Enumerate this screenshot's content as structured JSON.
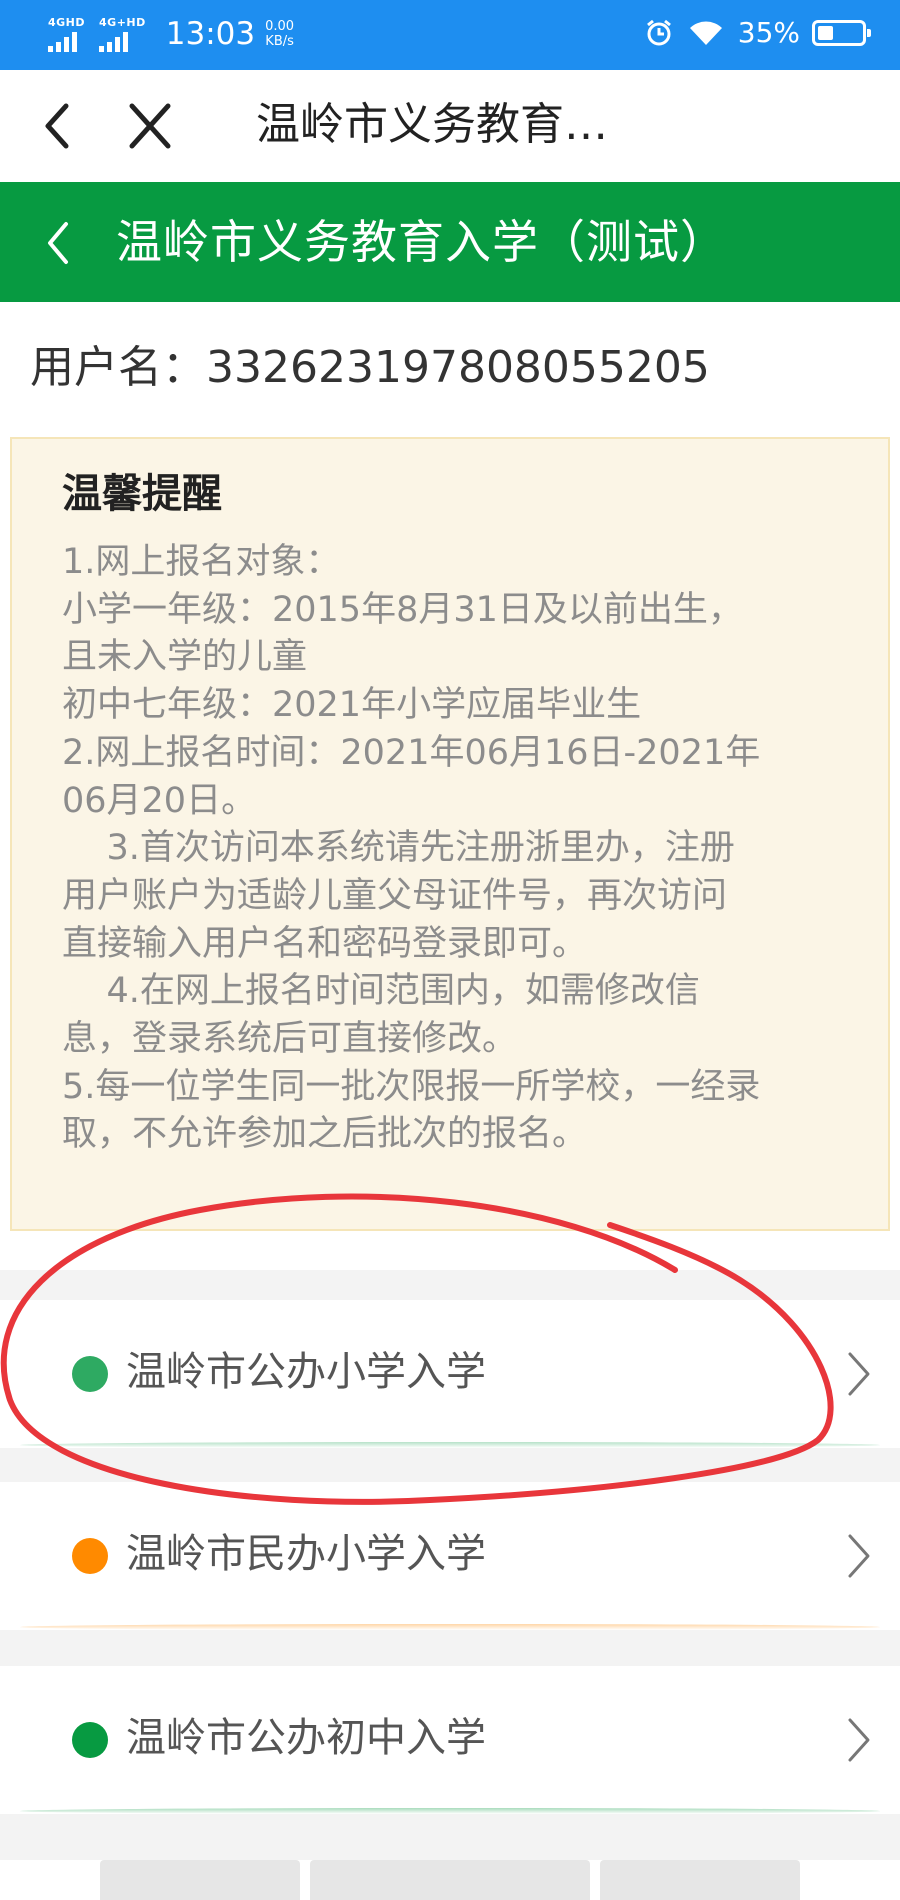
{
  "status_bar": {
    "signal1_label": "4GHD",
    "signal2_label": "4G+HD",
    "time": "13:03",
    "net_speed": "0.00",
    "net_unit": "KB/s",
    "battery_text": "35%",
    "battery_level": 0.35
  },
  "browser_nav": {
    "title": "温岭市义务教育…",
    "back_icon": "chevron-left-icon",
    "close_icon": "close-icon"
  },
  "app_header": {
    "title": "温岭市义务教育入学（测试）",
    "back_icon": "chevron-left-icon",
    "color": "#079a41"
  },
  "user": {
    "label": "用户名：",
    "value": "332623197808055205"
  },
  "notice": {
    "title": "温馨提醒",
    "lines": [
      "1.网上报名对象：",
      "小学一年级：2015年8月31日及以前出生，",
      "且未入学的儿童",
      "初中七年级：2021年小学应届毕业生",
      "2.网上报名时间：2021年06月16日-2021年",
      "06月20日。",
      "    3.首次访问本系统请先注册浙里办，注册",
      "用户账户为适龄儿童父母证件号，再次访问",
      "直接输入用户名和密码登录即可。",
      "    4.在网上报名时间范围内，如需修改信",
      "息，登录系统后可直接修改。",
      "5.每一位学生同一批次限报一所学校，一经录",
      "取，不允许参加之后批次的报名。"
    ]
  },
  "menu": [
    {
      "label": "温岭市公办小学入学",
      "dot_color": "#2eaa62",
      "icon": "chevron-right-icon"
    },
    {
      "label": "温岭市民办小学入学",
      "dot_color": "#ff8a00",
      "icon": "chevron-right-icon"
    },
    {
      "label": "温岭市公办初中入学",
      "dot_color": "#079a41",
      "icon": "chevron-right-icon"
    }
  ],
  "colors": {
    "status_bar": "#1e8ef0",
    "notice_bg": "#fbf5e6",
    "annotation": "#e8363b"
  }
}
